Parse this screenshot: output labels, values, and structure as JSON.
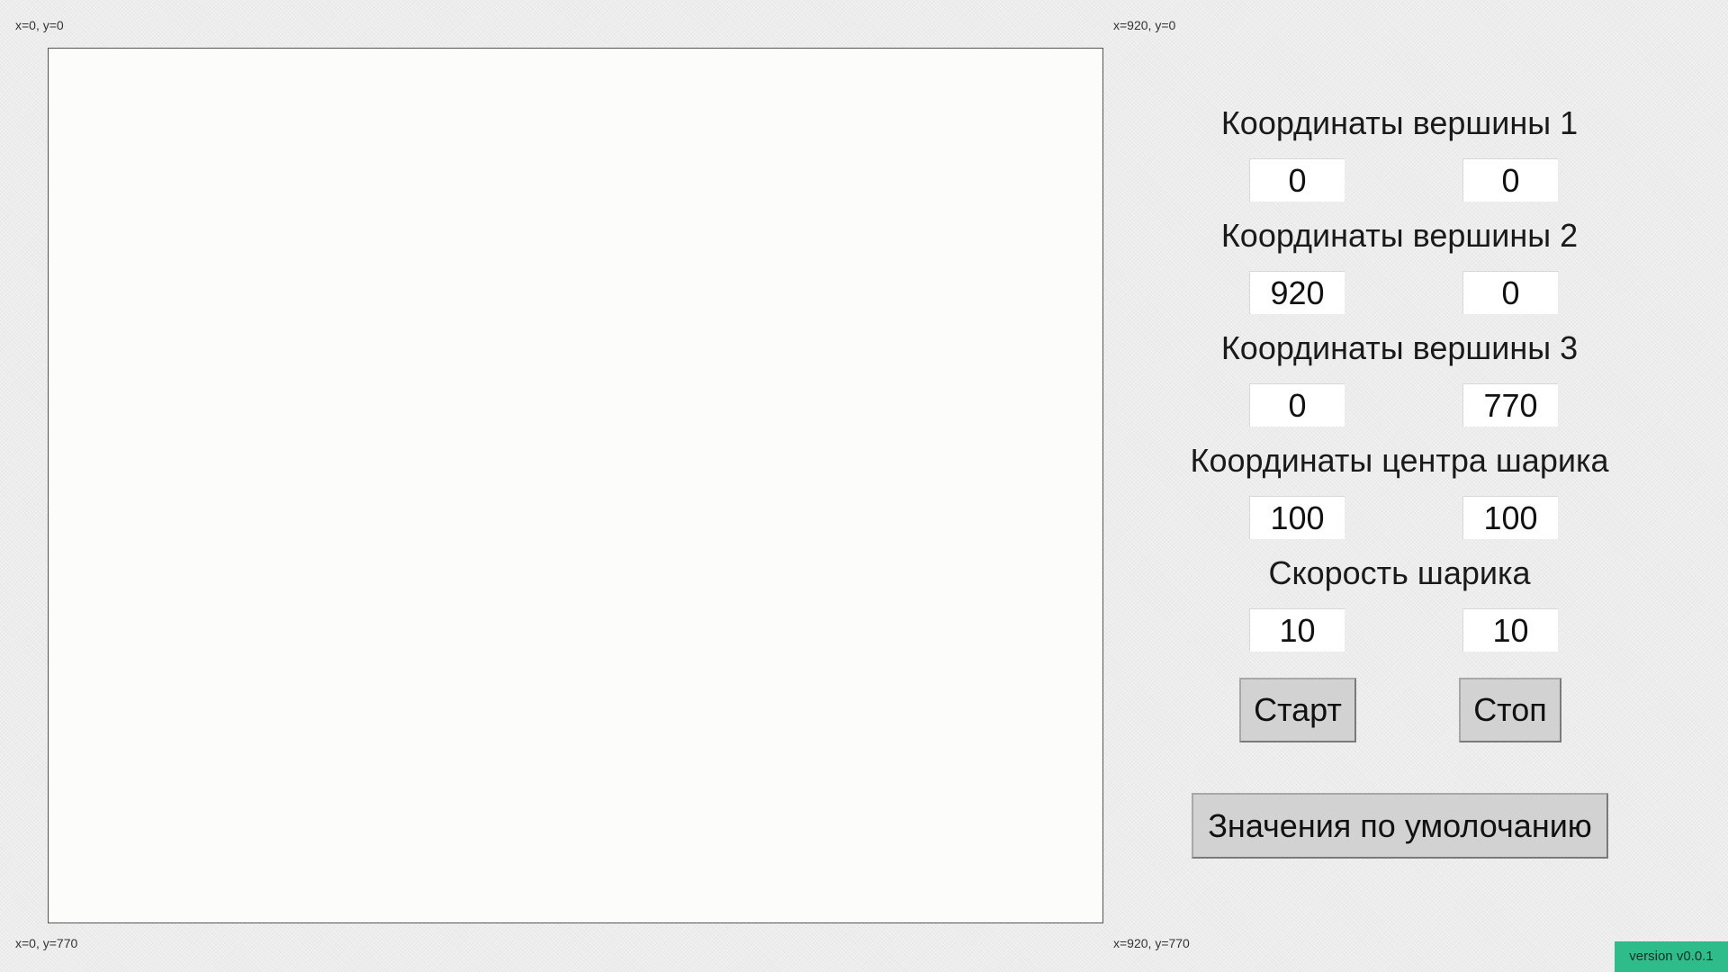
{
  "canvas_labels": {
    "top_left": "x=0, y=0",
    "top_right": "x=920, y=0",
    "bottom_left": "x=0, y=770",
    "bottom_right": "x=920, y=770"
  },
  "panel": {
    "vertex1": {
      "title": "Координаты вершины 1",
      "x": "0",
      "y": "0"
    },
    "vertex2": {
      "title": "Координаты вершины 2",
      "x": "920",
      "y": "0"
    },
    "vertex3": {
      "title": "Координаты вершины 3",
      "x": "0",
      "y": "770"
    },
    "ball_center": {
      "title": "Координаты центра шарика",
      "x": "100",
      "y": "100"
    },
    "ball_speed": {
      "title": "Скорость шарика",
      "x": "10",
      "y": "10"
    }
  },
  "buttons": {
    "start": "Старт",
    "stop": "Стоп",
    "defaults": "Значения по умолочанию"
  },
  "version": "version v0.0.1",
  "colors": {
    "version_badge": "#2ebc8a",
    "button_face": "#d2d2d2",
    "canvas_bg": "#fcfcfb"
  }
}
